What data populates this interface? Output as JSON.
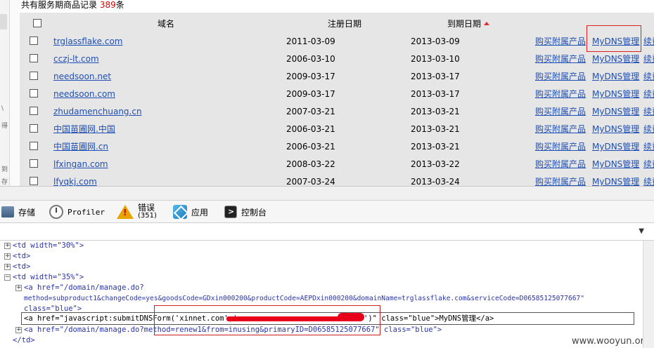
{
  "summary": {
    "prefix": "共有服务期商品记录",
    "count": "389",
    "suffix": "条"
  },
  "table": {
    "headers": {
      "domain": "域名",
      "reg_date": "注册日期",
      "exp_date": "到期日期"
    },
    "rows": [
      {
        "domain": "trglassflake.com",
        "reg": "2011-03-09",
        "exp": "2013-03-09",
        "buy": "购买附属产品",
        "dns": "MyDNS管理",
        "renew": "续费"
      },
      {
        "domain": "cczj-lt.com",
        "reg": "2006-03-10",
        "exp": "2013-03-10",
        "buy": "购买附属产品",
        "dns": "MyDNS管理",
        "renew": "续费"
      },
      {
        "domain": "needsoon.net",
        "reg": "2009-03-17",
        "exp": "2013-03-17",
        "buy": "购买附属产品",
        "dns": "MyDNS管理",
        "renew": "续费"
      },
      {
        "domain": "needsoon.com",
        "reg": "2009-03-17",
        "exp": "2013-03-17",
        "buy": "购买附属产品",
        "dns": "MyDNS管理",
        "renew": "续费"
      },
      {
        "domain": "zhudamenchuang.cn",
        "reg": "2007-03-21",
        "exp": "2013-03-21",
        "buy": "购买附属产品",
        "dns": "MyDNS管理",
        "renew": "续费"
      },
      {
        "domain": "中国苗圃网.中国",
        "reg": "2006-03-21",
        "exp": "2013-03-21",
        "buy": "购买附属产品",
        "dns": "MyDNS管理",
        "renew": "续费"
      },
      {
        "domain": "中国苗圃网.cn",
        "reg": "2006-03-21",
        "exp": "2013-03-21",
        "buy": "购买附属产品",
        "dns": "MyDNS管理",
        "renew": "续费"
      },
      {
        "domain": "lfxingan.com",
        "reg": "2008-03-22",
        "exp": "2013-03-22",
        "buy": "购买附属产品",
        "dns": "MyDNS管理",
        "renew": "续费"
      },
      {
        "domain": "lfyqkj.com",
        "reg": "2007-03-24",
        "exp": "2013-03-24",
        "buy": "购买附属产品",
        "dns": "MyDNS管理",
        "renew": "续费"
      }
    ]
  },
  "left_strip": {
    "chars": [
      "\\",
      "得",
      "到",
      "存"
    ]
  },
  "devtools": {
    "toolbar": {
      "storage": "存储",
      "profiler": "Profiler",
      "errors": "错误",
      "errors_count": "(351)",
      "apps": "应用",
      "console": "控制台"
    },
    "source_lines": {
      "l1": "<td width=\"30%\">",
      "l2": "<td>",
      "l3": "<td>",
      "l4": "<td width=\"35%\">",
      "l5": "<a href=\"/domain/manage.do?",
      "l6": "method=subproduct1&changeCode=yes&goodsCode=GDxin000200&productCode=AEPDxin000200&domainName=trglassflake.com&serviceCode=D06585125077667\"",
      "l7": "class=\"blue\">",
      "l8_start": "<a href=\"javascript:submitDNSForm('xinnet.com','",
      "l8_end": "')\" class=\"blue\">MyDNS管理</a>",
      "l9": "<a href=\"/domain/manage.do?method=renew1&from=inusing&primaryID=D06585125077667\" class=\"blue\">",
      "l10": "</td>"
    },
    "watermark": "www.wooyun.org"
  },
  "colors": {
    "link": "#1f4fb4",
    "count": "#e00000",
    "highlight": "#e02020",
    "panel": "#e6e6e6"
  }
}
